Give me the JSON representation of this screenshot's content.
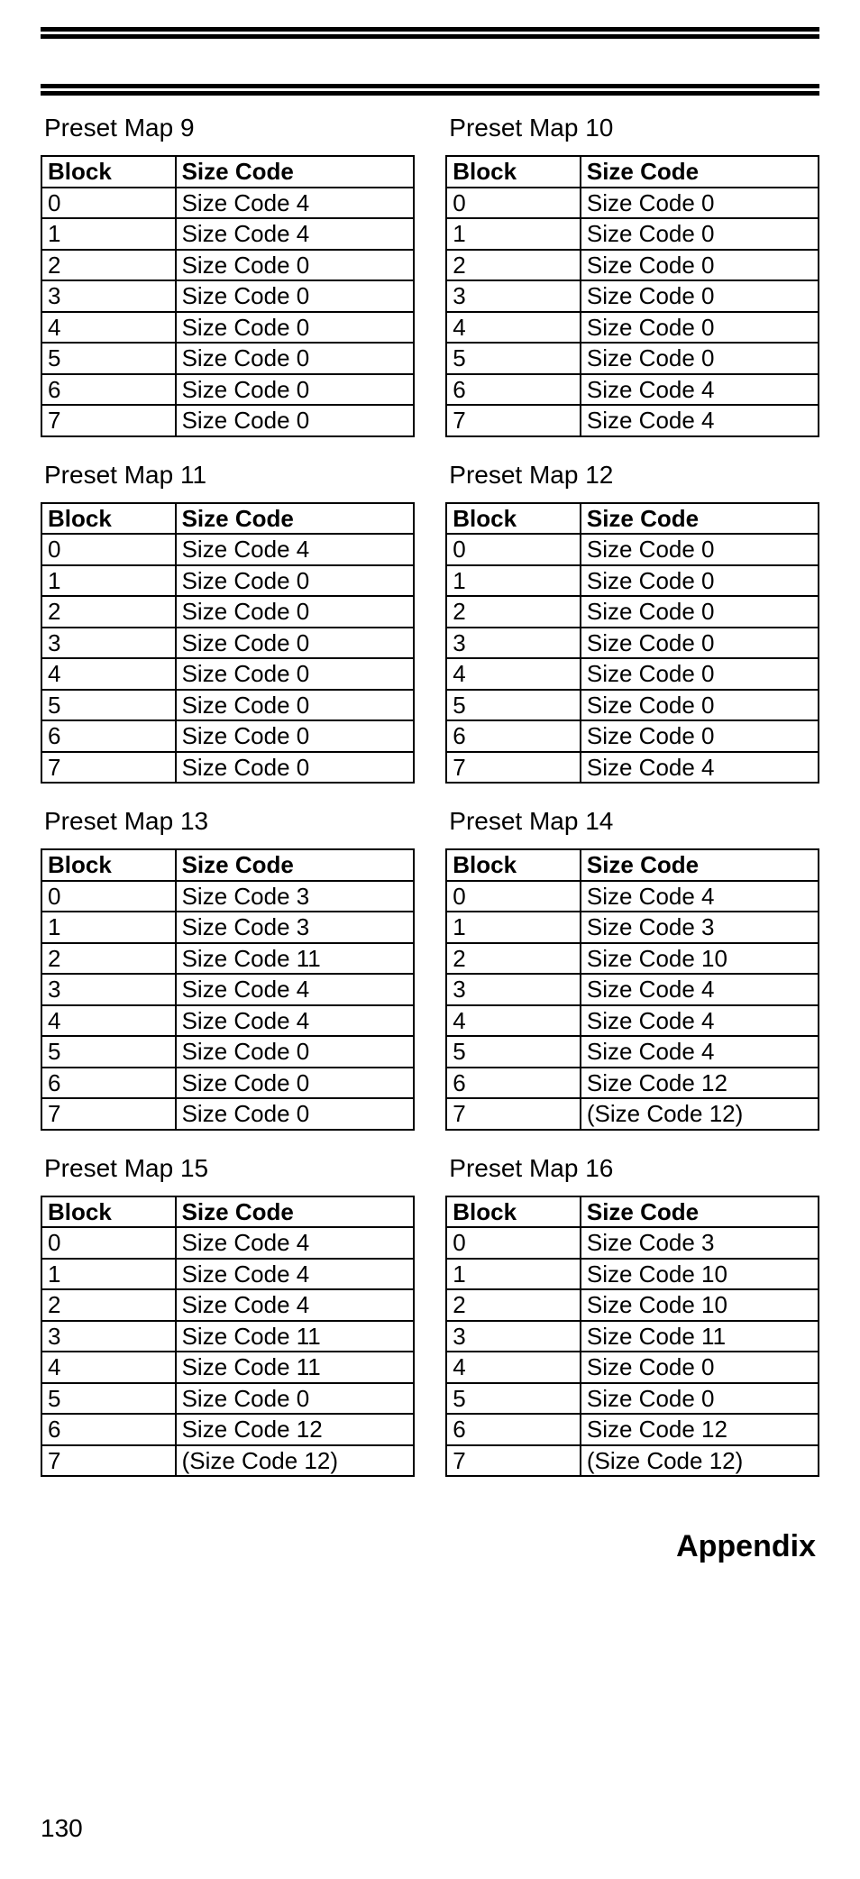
{
  "columns": {
    "block": "Block",
    "size": "Size Code"
  },
  "maps": [
    {
      "title": "Preset Map 9",
      "rows": [
        {
          "block": "0",
          "size": "Size Code 4"
        },
        {
          "block": "1",
          "size": "Size Code 4"
        },
        {
          "block": "2",
          "size": "Size Code 0"
        },
        {
          "block": "3",
          "size": "Size Code 0"
        },
        {
          "block": "4",
          "size": "Size Code 0"
        },
        {
          "block": "5",
          "size": "Size Code 0"
        },
        {
          "block": "6",
          "size": "Size Code 0"
        },
        {
          "block": "7",
          "size": "Size Code 0"
        }
      ]
    },
    {
      "title": "Preset Map 10",
      "rows": [
        {
          "block": "0",
          "size": "Size Code 0"
        },
        {
          "block": "1",
          "size": "Size Code 0"
        },
        {
          "block": "2",
          "size": "Size Code 0"
        },
        {
          "block": "3",
          "size": "Size Code 0"
        },
        {
          "block": "4",
          "size": "Size Code 0"
        },
        {
          "block": "5",
          "size": "Size Code 0"
        },
        {
          "block": "6",
          "size": "Size Code 4"
        },
        {
          "block": "7",
          "size": "Size Code 4"
        }
      ]
    },
    {
      "title": "Preset Map 11",
      "rows": [
        {
          "block": "0",
          "size": "Size Code 4"
        },
        {
          "block": "1",
          "size": "Size Code 0"
        },
        {
          "block": "2",
          "size": "Size Code 0"
        },
        {
          "block": "3",
          "size": "Size Code 0"
        },
        {
          "block": "4",
          "size": "Size Code 0"
        },
        {
          "block": "5",
          "size": "Size Code 0"
        },
        {
          "block": "6",
          "size": "Size Code 0"
        },
        {
          "block": "7",
          "size": "Size Code 0"
        }
      ]
    },
    {
      "title": "Preset Map 12",
      "rows": [
        {
          "block": "0",
          "size": "Size Code 0"
        },
        {
          "block": "1",
          "size": "Size Code 0"
        },
        {
          "block": "2",
          "size": "Size Code 0"
        },
        {
          "block": "3",
          "size": "Size Code 0"
        },
        {
          "block": "4",
          "size": "Size Code 0"
        },
        {
          "block": "5",
          "size": "Size Code 0"
        },
        {
          "block": "6",
          "size": "Size Code 0"
        },
        {
          "block": "7",
          "size": "Size Code 4"
        }
      ]
    },
    {
      "title": "Preset Map 13",
      "rows": [
        {
          "block": "0",
          "size": "Size Code 3"
        },
        {
          "block": "1",
          "size": "Size Code 3"
        },
        {
          "block": "2",
          "size": "Size Code 11"
        },
        {
          "block": "3",
          "size": "Size Code 4"
        },
        {
          "block": "4",
          "size": "Size Code 4"
        },
        {
          "block": "5",
          "size": "Size Code 0"
        },
        {
          "block": "6",
          "size": "Size Code 0"
        },
        {
          "block": "7",
          "size": "Size Code 0"
        }
      ]
    },
    {
      "title": "Preset Map 14",
      "rows": [
        {
          "block": "0",
          "size": "Size Code 4"
        },
        {
          "block": "1",
          "size": "Size Code 3"
        },
        {
          "block": "2",
          "size": "Size Code 10"
        },
        {
          "block": "3",
          "size": "Size Code 4"
        },
        {
          "block": "4",
          "size": "Size Code 4"
        },
        {
          "block": "5",
          "size": "Size Code 4"
        },
        {
          "block": "6",
          "size": "Size Code 12"
        },
        {
          "block": "7",
          "size": "(Size Code 12)"
        }
      ]
    },
    {
      "title": "Preset Map 15",
      "rows": [
        {
          "block": "0",
          "size": "Size Code 4"
        },
        {
          "block": "1",
          "size": "Size Code 4"
        },
        {
          "block": "2",
          "size": "Size Code 4"
        },
        {
          "block": "3",
          "size": "Size Code 11"
        },
        {
          "block": "4",
          "size": "Size Code 11"
        },
        {
          "block": "5",
          "size": "Size Code 0"
        },
        {
          "block": "6",
          "size": "Size Code 12"
        },
        {
          "block": "7",
          "size": "(Size Code 12)"
        }
      ]
    },
    {
      "title": "Preset Map 16",
      "rows": [
        {
          "block": "0",
          "size": "Size Code 3"
        },
        {
          "block": "1",
          "size": "Size Code 10"
        },
        {
          "block": "2",
          "size": "Size Code 10"
        },
        {
          "block": "3",
          "size": "Size Code 11"
        },
        {
          "block": "4",
          "size": "Size Code 0"
        },
        {
          "block": "5",
          "size": "Size Code 0"
        },
        {
          "block": "6",
          "size": "Size Code 12"
        },
        {
          "block": "7",
          "size": "(Size Code 12)"
        }
      ]
    }
  ],
  "section_label": "Appendix",
  "page_number": "130"
}
